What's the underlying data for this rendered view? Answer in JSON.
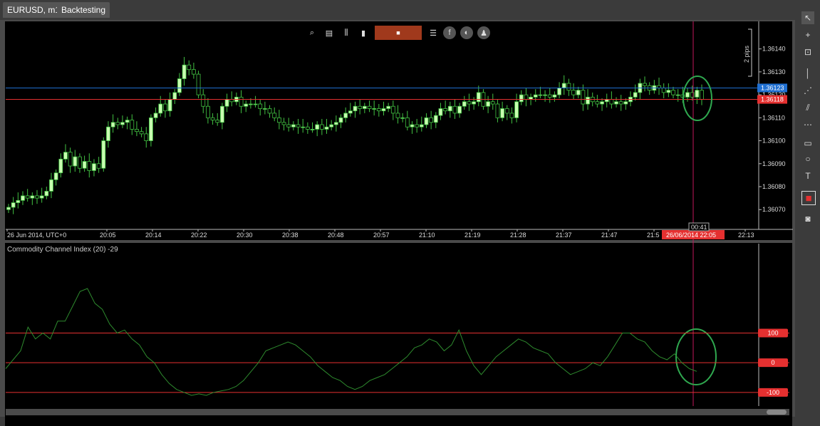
{
  "tabs": [
    {
      "label": "EURUSD, m1"
    },
    {
      "label": "Backtesting"
    }
  ],
  "chart_toolbar": [
    {
      "icon": "zoom-icon"
    },
    {
      "icon": "chart-settings-icon"
    },
    {
      "icon": "candles-icon"
    },
    {
      "icon": "timeframe-icon"
    },
    {
      "icon": "stop-icon"
    },
    {
      "icon": "list-icon"
    },
    {
      "icon": "facebook-icon"
    },
    {
      "icon": "trade-icon"
    },
    {
      "icon": "person-icon"
    }
  ],
  "right_toolbar": [
    {
      "icon": "pointer-icon"
    },
    {
      "icon": "crosshair-icon"
    },
    {
      "icon": "zoom-box-icon"
    },
    {
      "icon": "vertical-line-icon"
    },
    {
      "icon": "fan-icon"
    },
    {
      "icon": "channel-icon"
    },
    {
      "icon": "fibonacci-icon"
    },
    {
      "icon": "rectangle-icon"
    },
    {
      "icon": "ellipse-icon"
    },
    {
      "icon": "text-icon"
    },
    {
      "icon": "color-icon"
    },
    {
      "icon": "camera-icon"
    }
  ],
  "colors": {
    "up_candle": "#c8ffb0",
    "candle_outline": "#42c242",
    "cci_line": "#2e8b2e",
    "level_line": "#e53030",
    "ask_line": "#1f6fd1",
    "crosshair": "#c2185b",
    "highlight_ellipse": "#2fa84f"
  },
  "chart_data": [
    {
      "type": "candlestick",
      "symbol": "EURUSD",
      "timeframe": "m1",
      "title": "EURUSD, m1",
      "ylim": [
        1.36062,
        1.36152
      ],
      "y_ticks": [
        "1.36140",
        "1.36130",
        "1.36120",
        "1.36110",
        "1.36100",
        "1.36090",
        "1.36080",
        "1.36070"
      ],
      "x_ticks": [
        "26 Jun 2014, UTC+0",
        "20:05",
        "20:14",
        "20:22",
        "20:30",
        "20:38",
        "20:48",
        "20:57",
        "21:10",
        "21:19",
        "21:28",
        "21:37",
        "21:47",
        "21:5",
        "22:13"
      ],
      "pips_label": "2 pips",
      "ask_price": "1.36123",
      "bid_price": "1.36118",
      "cursor_time": "26/06/2014 22:05",
      "countdown": "00:41",
      "closes": [
        1.36071,
        1.36073,
        1.36074,
        1.36076,
        1.36075,
        1.36076,
        1.36075,
        1.36076,
        1.36078,
        1.36083,
        1.36086,
        1.36092,
        1.36095,
        1.36089,
        1.36093,
        1.36088,
        1.36091,
        1.36087,
        1.3609,
        1.36088,
        1.361,
        1.36106,
        1.36108,
        1.36107,
        1.36108,
        1.36109,
        1.36105,
        1.36104,
        1.36103,
        1.361,
        1.3611,
        1.36112,
        1.36116,
        1.36113,
        1.36118,
        1.36121,
        1.36127,
        1.36133,
        1.36131,
        1.36129,
        1.3612,
        1.36115,
        1.3611,
        1.36109,
        1.36108,
        1.36115,
        1.36118,
        1.36117,
        1.36119,
        1.36115,
        1.36116,
        1.36116,
        1.36116,
        1.36114,
        1.36114,
        1.36112,
        1.3611,
        1.36108,
        1.36107,
        1.36106,
        1.36107,
        1.36106,
        1.36106,
        1.36105,
        1.36105,
        1.36107,
        1.36105,
        1.36106,
        1.36107,
        1.36108,
        1.3611,
        1.36112,
        1.36113,
        1.36115,
        1.36114,
        1.36115,
        1.36114,
        1.36114,
        1.36113,
        1.36114,
        1.36115,
        1.36112,
        1.3611,
        1.3611,
        1.36106,
        1.36107,
        1.36106,
        1.36107,
        1.3611,
        1.36108,
        1.36111,
        1.36114,
        1.36113,
        1.36115,
        1.36112,
        1.36115,
        1.36117,
        1.36116,
        1.36117,
        1.36121,
        1.36115,
        1.36117,
        1.36116,
        1.3611,
        1.36114,
        1.36112,
        1.3611,
        1.36117,
        1.3612,
        1.36118,
        1.36119,
        1.3612,
        1.3612,
        1.3612,
        1.36119,
        1.3612,
        1.36123,
        1.36125,
        1.36122,
        1.3612,
        1.36122,
        1.36116,
        1.36119,
        1.36117,
        1.36116,
        1.36117,
        1.36118,
        1.36116,
        1.36117,
        1.36116,
        1.36117,
        1.36119,
        1.36121,
        1.36125,
        1.36124,
        1.36122,
        1.36124,
        1.36123,
        1.36121,
        1.36122,
        1.3612,
        1.3612,
        1.36119,
        1.36121,
        1.36119,
        1.36122,
        1.36118
      ]
    },
    {
      "type": "line",
      "title": "Commodity Channel Index (20) -29",
      "levels": [
        "100",
        "0",
        "-100"
      ],
      "ylim": [
        -110,
        370
      ],
      "values": [
        -20,
        10,
        40,
        120,
        80,
        100,
        80,
        140,
        140,
        190,
        240,
        250,
        200,
        180,
        130,
        100,
        110,
        80,
        60,
        20,
        0,
        -40,
        -70,
        -90,
        -100,
        -110,
        -105,
        -110,
        -100,
        -95,
        -90,
        -80,
        -60,
        -30,
        0,
        40,
        50,
        60,
        70,
        60,
        40,
        20,
        -10,
        -30,
        -50,
        -60,
        -80,
        -90,
        -80,
        -60,
        -50,
        -40,
        -20,
        0,
        20,
        50,
        60,
        80,
        70,
        40,
        60,
        110,
        40,
        -10,
        -40,
        -10,
        20,
        40,
        60,
        80,
        70,
        50,
        40,
        30,
        0,
        -20,
        -40,
        -30,
        -20,
        0,
        -10,
        20,
        60,
        100,
        100,
        80,
        70,
        40,
        20,
        10,
        30,
        0,
        -20,
        -29
      ]
    }
  ]
}
